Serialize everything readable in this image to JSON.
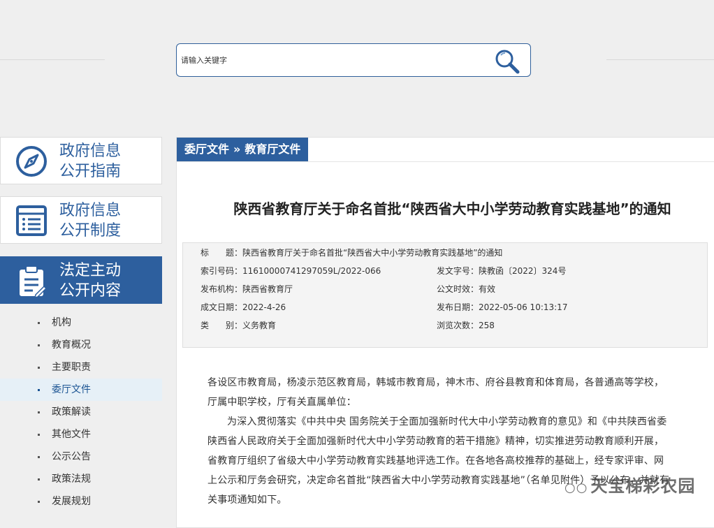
{
  "search": {
    "placeholder": "请输入关键字"
  },
  "sidebar": {
    "cards": [
      {
        "line1": "政府信息",
        "line2": "公开指南",
        "icon": "compass-icon"
      },
      {
        "line1": "政府信息",
        "line2": "公开制度",
        "icon": "list-document-icon"
      },
      {
        "line1": "法定主动",
        "line2": "公开内容",
        "icon": "clipboard-icon"
      }
    ],
    "items": [
      "机构",
      "教育概况",
      "主要职责",
      "委厅文件",
      "政策解读",
      "其他文件",
      "公示公告",
      "政策法规",
      "发展规划"
    ],
    "active_item": "委厅文件"
  },
  "breadcrumb": {
    "first": "委厅文件",
    "separator": "»",
    "second": "教育厅文件"
  },
  "document": {
    "title": "陕西省教育厅关于命名首批“陕西省大中小学劳动教育实践基地”的通知",
    "meta": {
      "title_row": "标　　题：陕西省教育厅关于命名首批“陕西省大中小学劳动教育实践基地”的通知",
      "index_no": "索引号码：11610000741297059L/2022-066",
      "doc_no": "发文字号：陕教函〔2022〕324号",
      "issuer": "发布机构：陕西省教育厅",
      "validity": "公文时效：有效",
      "created": "成文日期：2022-4-26",
      "published": "发布日期：2022-05-06 10:13:17",
      "category": "类　　别：义务教育",
      "views": "浏览次数：258"
    },
    "body": [
      "各设区市教育局，杨凌示范区教育局，韩城市教育局，神木市、府谷县教育和体育局，各普通高等学校，厅属中职学校，厅有关直属单位：",
      "为深入贯彻落实《中共中央 国务院关于全面加强新时代大中小学劳动教育的意见》和《中共陕西省委 陕西省人民政府关于全面加强新时代大中小学劳动教育的若干措施》精神，切实推进劳动教育顺利开展，省教育厅组织了省级大中小学劳动教育实践基地评选工作。在各地各高校推荐的基础上，经专家评审、网上公示和厅务会研究，决定命名首批“陕西省大中小学劳动教育实践基地”（名单见附件）予以公布，并就有关事项通知如下。"
    ]
  },
  "watermark": {
    "text": "天宝梯彩农园",
    "icon": "wechat-bubble-icon"
  },
  "colors": {
    "primary": "#2d5f9e",
    "background": "#efefef"
  }
}
